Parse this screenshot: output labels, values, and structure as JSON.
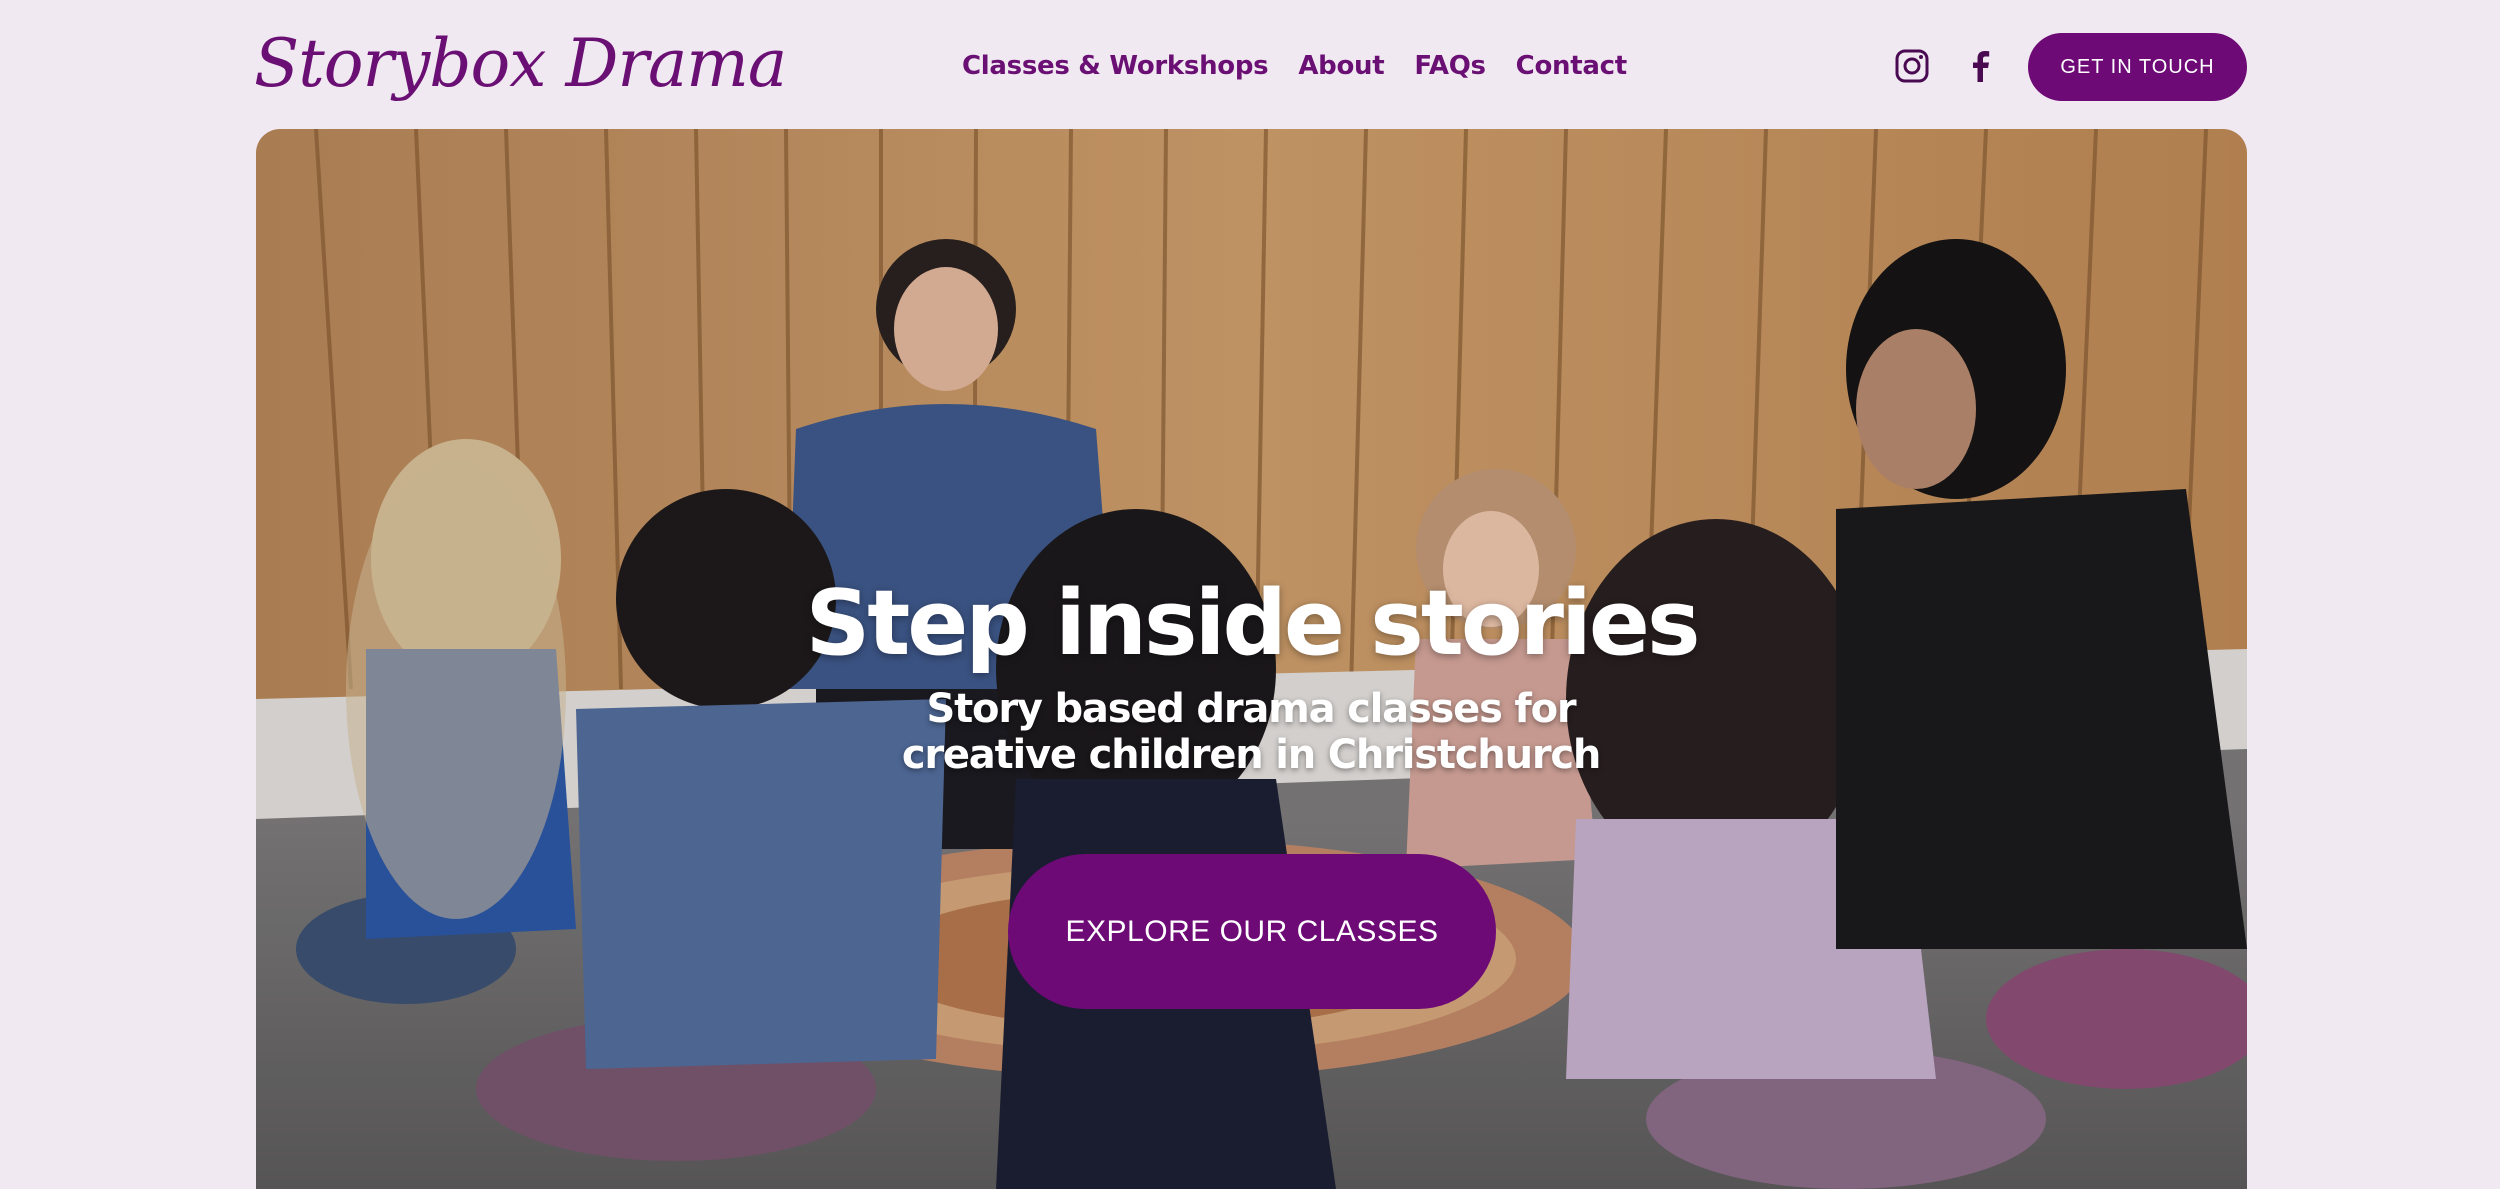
{
  "brand": {
    "logo_text": "Storybox Drama",
    "accent_color": "#6d0a76",
    "background_color": "#f1e9f1"
  },
  "nav": {
    "items": [
      {
        "label": "Classes & Workshops"
      },
      {
        "label": "About"
      },
      {
        "label": "FAQs"
      },
      {
        "label": "Contact"
      }
    ]
  },
  "social": {
    "instagram_icon": "instagram-icon",
    "facebook_icon": "facebook-icon"
  },
  "header_cta": {
    "label": "GET IN TOUCH"
  },
  "hero": {
    "title": "Step inside stories",
    "subtitle": "Story based drama classes for creative children in Christchurch",
    "cta_label": "EXPLORE OUR CLASSES"
  }
}
